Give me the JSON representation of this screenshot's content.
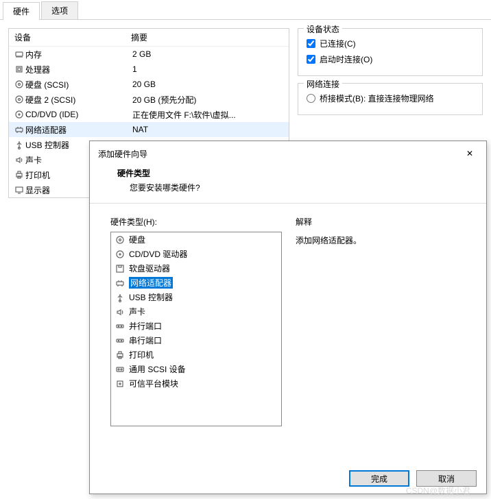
{
  "tabs": {
    "hardware": "硬件",
    "options": "选项"
  },
  "hwList": {
    "headDevice": "设备",
    "headSummary": "摘要",
    "items": [
      {
        "name": "内存",
        "summary": "2 GB",
        "icon": "memory"
      },
      {
        "name": "处理器",
        "summary": "1",
        "icon": "cpu"
      },
      {
        "name": "硬盘 (SCSI)",
        "summary": "20 GB",
        "icon": "hdd"
      },
      {
        "name": "硬盘 2 (SCSI)",
        "summary": "20 GB (预先分配)",
        "icon": "hdd"
      },
      {
        "name": "CD/DVD (IDE)",
        "summary": "正在使用文件 F:\\软件\\虚拟...",
        "icon": "cd"
      },
      {
        "name": "网络适配器",
        "summary": "NAT",
        "icon": "net",
        "highlight": true
      },
      {
        "name": "USB 控制器",
        "summary": "",
        "icon": "usb"
      },
      {
        "name": "声卡",
        "summary": "",
        "icon": "sound"
      },
      {
        "name": "打印机",
        "summary": "",
        "icon": "printer"
      },
      {
        "name": "显示器",
        "summary": "",
        "icon": "display"
      }
    ]
  },
  "deviceStatus": {
    "legend": "设备状态",
    "connected": "已连接(C)",
    "connectOnStart": "启动时连接(O)"
  },
  "netConn": {
    "legend": "网络连接",
    "bridge": "桥接模式(B): 直接连接物理网络"
  },
  "wizard": {
    "title": "添加硬件向导",
    "headerTitle": "硬件类型",
    "headerSub": "您要安装哪类硬件?",
    "listLabel": "硬件类型(H):",
    "explainLabel": "解释",
    "explainText": "添加网络适配器。",
    "finish": "完成",
    "cancel": "取消",
    "types": [
      {
        "name": "硬盘",
        "icon": "hdd"
      },
      {
        "name": "CD/DVD 驱动器",
        "icon": "cd"
      },
      {
        "name": "软盘驱动器",
        "icon": "floppy"
      },
      {
        "name": "网络适配器",
        "icon": "net",
        "selected": true
      },
      {
        "name": "USB 控制器",
        "icon": "usb"
      },
      {
        "name": "声卡",
        "icon": "sound"
      },
      {
        "name": "并行端口",
        "icon": "port"
      },
      {
        "name": "串行端口",
        "icon": "port"
      },
      {
        "name": "打印机",
        "icon": "printer"
      },
      {
        "name": "通用 SCSI 设备",
        "icon": "scsi"
      },
      {
        "name": "可信平台模块",
        "icon": "tpm"
      }
    ]
  },
  "watermark": "CSDN@数据小君"
}
